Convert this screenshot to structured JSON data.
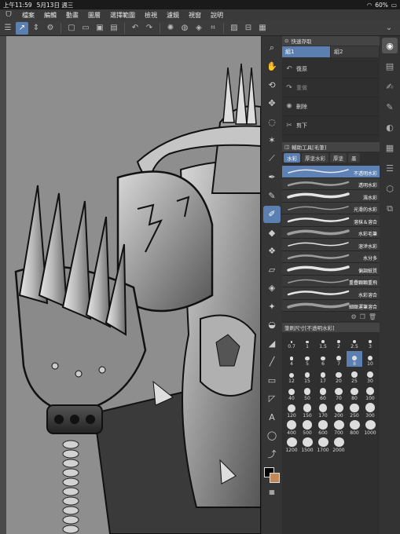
{
  "status": {
    "time": "上午11:59",
    "date": "5月13日 週三",
    "battery": "60%"
  },
  "menu": [
    "檔案",
    "編輯",
    "動畫",
    "圖層",
    "選擇範圍",
    "檢視",
    "濾鏡",
    "視窗",
    "說明"
  ],
  "quick_access": {
    "title": "快速存取",
    "tabs": [
      "組1",
      "組2"
    ],
    "items": [
      {
        "label": "復原",
        "icon": "undo-icon"
      },
      {
        "label": "重做",
        "icon": "redo-icon"
      },
      {
        "label": "刪除",
        "icon": "clear-icon"
      },
      {
        "label": "剪下",
        "icon": "cut-icon"
      }
    ]
  },
  "subtool": {
    "title": "輔助工具[毛筆]",
    "tabs": [
      "水彩",
      "厚塗水彩",
      "厚塗",
      "墨"
    ],
    "brushes": [
      "不透明水彩",
      "透明水彩",
      "濕水彩",
      "光滑的水彩",
      "溶抹＆溶合",
      "水彩毛筆",
      "溶滲水彩",
      "水分多",
      "偏調紙質",
      "重疊顆顆重飛",
      "水彩溶合",
      "細緻運筆溶合"
    ]
  },
  "brush_size": {
    "title": "筆刷尺寸[不透明水彩]",
    "sizes": [
      "0.7",
      "1",
      "1.5",
      "2",
      "2.5",
      "3",
      "4",
      "5",
      "6",
      "7",
      "8",
      "10",
      "12",
      "15",
      "17",
      "20",
      "25",
      "30",
      "40",
      "50",
      "60",
      "70",
      "80",
      "100",
      "120",
      "150",
      "170",
      "200",
      "250",
      "300",
      "400",
      "500",
      "600",
      "700",
      "800",
      "1000",
      "1200",
      "1500",
      "1700",
      "2000"
    ],
    "selected": "8"
  },
  "colors": {
    "accent": "#5a7fb0",
    "foreground": "#000000",
    "background": "#c0895a"
  }
}
